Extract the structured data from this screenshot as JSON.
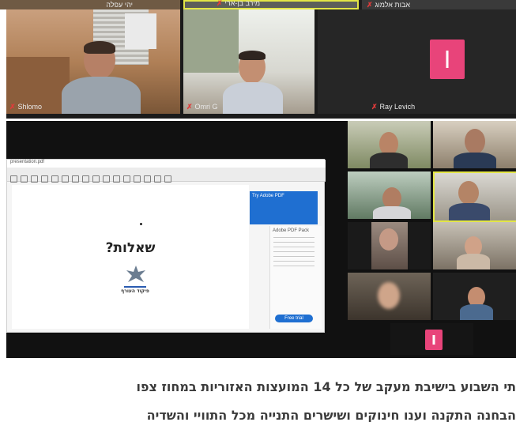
{
  "top_strip": {
    "left_name": "יהי עפלה",
    "center_name": "מירב בן-ארי",
    "right_name": "אבות אלמוג"
  },
  "grid_top": {
    "tiles": [
      {
        "name": "Shlomo"
      },
      {
        "name": "Omri G"
      },
      {
        "name": "Ray Levich"
      }
    ]
  },
  "share": {
    "window_title": "presentation.pdf",
    "slide_title": "שאלות?",
    "slide_caption": "פיקוד העורף",
    "popup_title": "Try Adobe PDF",
    "side_panel_title": "Adobe PDF Pack",
    "side_button": "Free trial"
  },
  "caption": {
    "line1": "תי השבוע בישיבת מעקב של כל 14 המועצות האזוריות במחוז צפו",
    "line2": "הבחנה התקנה וענו חינוקים ושישרים התנייה מכל התוויי והשדיה"
  }
}
